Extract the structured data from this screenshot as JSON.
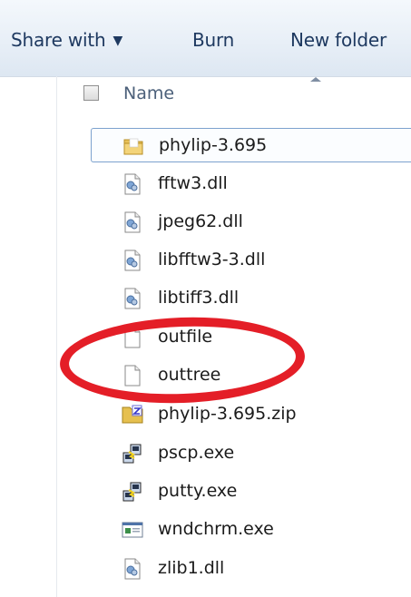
{
  "toolbar": {
    "share_label": "Share with",
    "share_arrow": "▼",
    "burn_label": "Burn",
    "new_folder_label": "New folder"
  },
  "column_header": {
    "name_label": "Name",
    "sort_direction": "ascending"
  },
  "files": [
    {
      "name": "phylip-3.695",
      "icon": "folder-icon",
      "selected": true
    },
    {
      "name": "fftw3.dll",
      "icon": "dll-file-icon"
    },
    {
      "name": "jpeg62.dll",
      "icon": "dll-file-icon"
    },
    {
      "name": "libfftw3-3.dll",
      "icon": "dll-file-icon"
    },
    {
      "name": "libtiff3.dll",
      "icon": "dll-file-icon"
    },
    {
      "name": "outfile",
      "icon": "blank-file-icon",
      "circled": true
    },
    {
      "name": "outtree",
      "icon": "blank-file-icon",
      "circled": true
    },
    {
      "name": "phylip-3.695.zip",
      "icon": "zip-file-icon"
    },
    {
      "name": "pscp.exe",
      "icon": "putty-exe-icon"
    },
    {
      "name": "putty.exe",
      "icon": "putty-exe-icon"
    },
    {
      "name": "wndchrm.exe",
      "icon": "window-exe-icon"
    },
    {
      "name": "zlib1.dll",
      "icon": "dll-file-icon"
    }
  ],
  "annotation": {
    "color": "#e41e27",
    "shape": "ellipse around outfile and outtree"
  }
}
